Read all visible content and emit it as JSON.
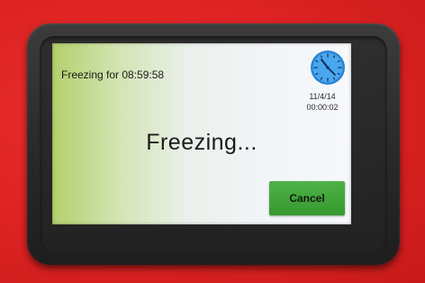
{
  "screen": {
    "timer_label": "Freezing for 08:59:58",
    "date": "11/4/14",
    "time": "00:00:02",
    "status": "Freezing...",
    "cancel_label": "Cancel"
  },
  "icons": {
    "clock": "clock-icon"
  },
  "colors": {
    "enclosure": "#dc2222",
    "bezel": "#2a2a2a",
    "cancel_button": "#3fa838",
    "clock_face": "#3d9ce6"
  }
}
